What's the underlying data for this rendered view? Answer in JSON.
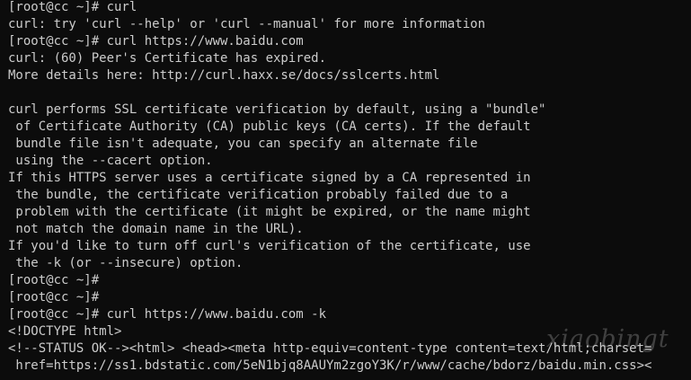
{
  "terminal": {
    "lines": [
      "[root@cc ~]# curl",
      "curl: try 'curl --help' or 'curl --manual' for more information",
      "[root@cc ~]# curl https://www.baidu.com",
      "curl: (60) Peer's Certificate has expired.",
      "More details here: http://curl.haxx.se/docs/sslcerts.html",
      "",
      "curl performs SSL certificate verification by default, using a \"bundle\"",
      " of Certificate Authority (CA) public keys (CA certs). If the default",
      " bundle file isn't adequate, you can specify an alternate file",
      " using the --cacert option.",
      "If this HTTPS server uses a certificate signed by a CA represented in",
      " the bundle, the certificate verification probably failed due to a",
      " problem with the certificate (it might be expired, or the name might",
      " not match the domain name in the URL).",
      "If you'd like to turn off curl's verification of the certificate, use",
      " the -k (or --insecure) option.",
      "[root@cc ~]#",
      "[root@cc ~]#",
      "[root@cc ~]# curl https://www.baidu.com -k",
      "<!DOCTYPE html>",
      "<!--STATUS OK--><html> <head><meta http-equiv=content-type content=text/html;charset=",
      " href=https://ss1.bdstatic.com/5eN1bjq8AAUYm2zgoY3K/r/www/cache/bdorz/baidu.min.css><"
    ]
  },
  "watermark": {
    "text": "xiaobingt"
  },
  "colors": {
    "background": "#0c0c0c",
    "foreground": "#cccccc"
  }
}
